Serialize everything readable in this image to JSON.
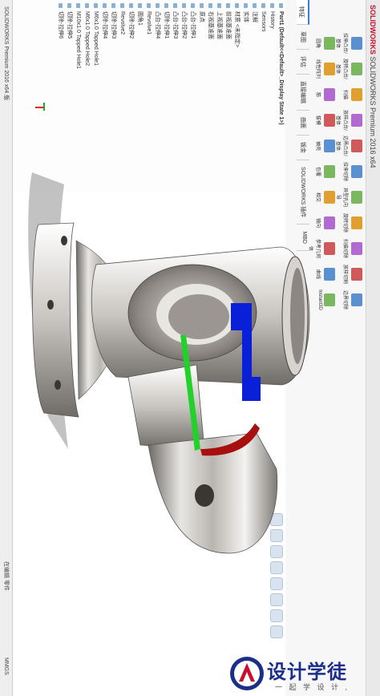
{
  "app": {
    "title": "SOLIDWORKS",
    "window_title": "SOLIDWORKS Premium 2016 x64"
  },
  "ribbon": {
    "tabs": [
      "特征",
      "草图",
      "评估",
      "直接编辑",
      "曲面",
      "钣金",
      "SOLIDWORKS 插件",
      "MBD"
    ],
    "buttons": [
      "拉伸凸台/基体",
      "旋转凸台/基体",
      "扫描",
      "放样凸台/基体",
      "边界凸台/基体",
      "拉伸切除",
      "异型孔向导",
      "旋转切除",
      "扫描切除",
      "放样切割",
      "边界切除",
      "圆角",
      "线性阵列",
      "筋",
      "拔模",
      "抽壳",
      "包覆",
      "相交",
      "镜向",
      "参考几何体",
      "曲线",
      "Instant3D"
    ]
  },
  "tree": {
    "root": "Part1 (Default<<Default>_Display State 1>)",
    "items": [
      "History",
      "Sensors",
      "注解",
      "实体",
      "材质 <未指定>",
      "前视基准面",
      "上视基准面",
      "右视基准面",
      "原点",
      "凸台-拉伸1",
      "凸台-拉伸2",
      "凸台-拉伸3",
      "切除-拉伸1",
      "凸台-拉伸4",
      "Revolve1",
      "圆角1",
      "切除-拉伸2",
      "Revolve2",
      "切除-拉伸3",
      "切除-拉伸4",
      "M6x1.0 Tapped Hole1",
      "M6x1.0 Tapped Hole2",
      "M10x1.0 Tapped Hole1",
      "切除-拉伸5",
      "切除-拉伸6"
    ]
  },
  "status": {
    "left": "SOLIDWORKS Premium 2016 x64 版",
    "right": "在编辑 零件",
    "units": "MMGS"
  },
  "watermark": {
    "brand": "设计学徒",
    "sub": "一 起 学 设 计 ,"
  },
  "colors": {
    "brand_red": "#c8102e",
    "section_blue": "#0a1fd8",
    "section_green": "#22d22a",
    "section_red": "#a80f0f",
    "logo_blue": "#1b2f8a"
  }
}
